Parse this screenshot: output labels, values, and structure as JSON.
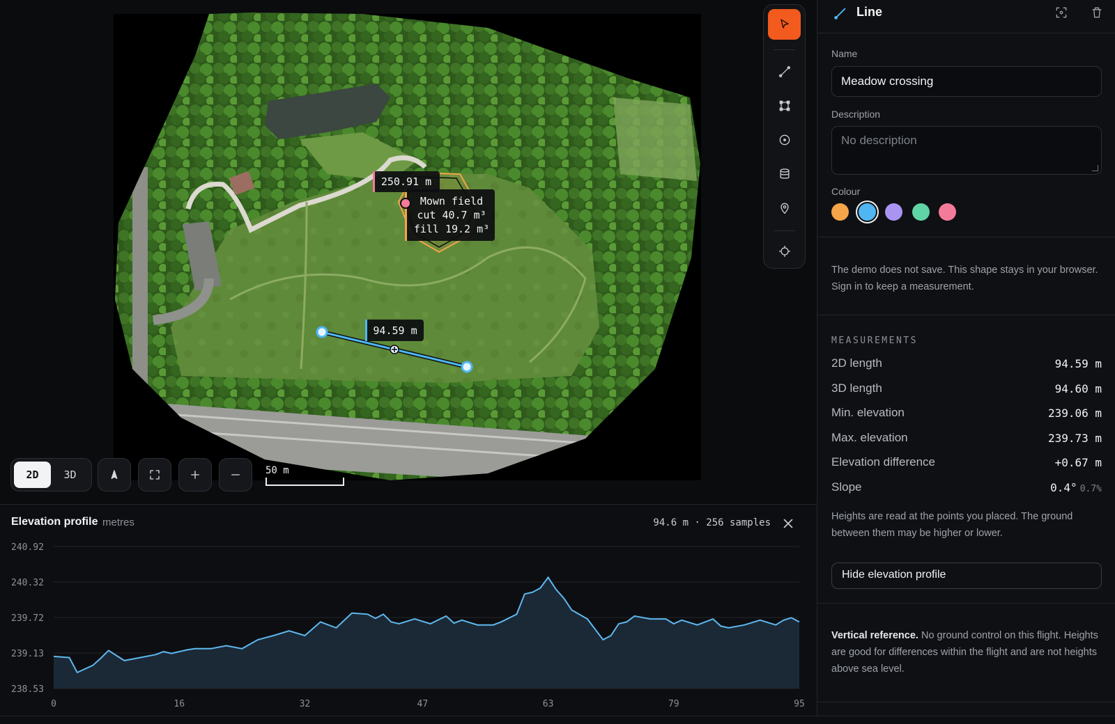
{
  "map": {
    "segment_line_label": "250.91 m",
    "area_label": {
      "name": "Mown field",
      "cut": "cut 40.7 m³",
      "fill": "fill 19.2 m³"
    },
    "measure_label": "94.59 m",
    "scale_label": "50 m",
    "view_modes": [
      "2D",
      "3D"
    ],
    "active_view": "2D"
  },
  "toolbar": {
    "tools": [
      {
        "name": "select-tool",
        "icon": "cursor-arrow-icon",
        "active": true
      },
      {
        "name": "line-tool",
        "icon": "line-icon",
        "active": false
      },
      {
        "name": "polygon-tool",
        "icon": "polygon-icon",
        "active": false
      },
      {
        "name": "circle-tool",
        "icon": "circle-dot-icon",
        "active": false
      },
      {
        "name": "volume-tool",
        "icon": "database-icon",
        "active": false
      },
      {
        "name": "marker-tool",
        "icon": "map-pin-icon",
        "active": false
      },
      {
        "name": "locate-tool",
        "icon": "crosshair-icon",
        "active": false
      }
    ],
    "accent_color": "#f25a1e"
  },
  "elevation": {
    "title": "Elevation profile",
    "unit": "metres",
    "summary": "94.6 m · 256 samples",
    "y_ticks": [
      "240.92",
      "240.32",
      "239.72",
      "239.13",
      "238.53"
    ],
    "x_ticks": [
      "0",
      "16",
      "32",
      "47",
      "63",
      "79",
      "95"
    ]
  },
  "chart_data": {
    "type": "area",
    "title": "Elevation profile",
    "xlabel": "",
    "ylabel": "metres",
    "xlim": [
      0,
      95
    ],
    "ylim": [
      238.53,
      240.92
    ],
    "x": [
      0,
      2,
      3,
      5,
      6,
      7,
      9,
      11,
      13,
      14,
      15,
      17,
      18,
      20,
      22,
      24,
      26,
      28,
      30,
      32,
      34,
      36,
      38,
      40,
      41,
      42,
      43,
      44,
      46,
      48,
      50,
      51,
      52,
      54,
      56,
      57,
      59,
      60,
      61,
      62,
      63,
      64,
      65,
      66,
      68,
      70,
      71,
      72,
      73,
      74,
      76,
      78,
      79,
      80,
      82,
      84,
      85,
      86,
      88,
      90,
      92,
      93,
      94,
      95
    ],
    "y": [
      239.07,
      239.05,
      238.8,
      238.92,
      239.04,
      239.17,
      239.0,
      239.05,
      239.1,
      239.15,
      239.12,
      239.18,
      239.2,
      239.2,
      239.25,
      239.2,
      239.35,
      239.42,
      239.5,
      239.42,
      239.65,
      239.55,
      239.8,
      239.78,
      239.71,
      239.78,
      239.65,
      239.62,
      239.7,
      239.62,
      239.75,
      239.63,
      239.68,
      239.6,
      239.6,
      239.65,
      239.78,
      240.12,
      240.15,
      240.22,
      240.4,
      240.2,
      240.05,
      239.85,
      239.7,
      239.35,
      239.42,
      239.62,
      239.65,
      239.75,
      239.7,
      239.7,
      239.62,
      239.68,
      239.6,
      239.7,
      239.58,
      239.55,
      239.6,
      239.68,
      239.6,
      239.68,
      239.72,
      239.65
    ]
  },
  "panel": {
    "type_label": "Line",
    "name_label": "Name",
    "name_value": "Meadow crossing",
    "description_label": "Description",
    "description_placeholder": "No description",
    "colour_label": "Colour",
    "colours": [
      "#f6a54a",
      "#4fb6f2",
      "#a994f2",
      "#5fd4a6",
      "#f47a9a"
    ],
    "selected_colour": "#4fb6f2",
    "demo_note": "The demo does not save. This shape stays in your browser. Sign in to keep a measurement.",
    "measurements_heading": "MEASUREMENTS",
    "measurements": [
      {
        "label": "2D length",
        "value": "94.59 m",
        "extra": ""
      },
      {
        "label": "3D length",
        "value": "94.60 m",
        "extra": ""
      },
      {
        "label": "Min. elevation",
        "value": "239.06 m",
        "extra": ""
      },
      {
        "label": "Max. elevation",
        "value": "239.73 m",
        "extra": ""
      },
      {
        "label": "Elevation difference",
        "value": "+0.67 m",
        "extra": ""
      },
      {
        "label": "Slope",
        "value": "0.4°",
        "extra": "0.7%"
      }
    ],
    "heights_note": "Heights are read at the points you placed. The ground between them may be higher or lower.",
    "hide_profile_label": "Hide elevation profile",
    "vref_bold": "Vertical reference.",
    "vref_text": " No ground control on this flight. Heights are good for differences within the flight and are not heights above sea level."
  }
}
